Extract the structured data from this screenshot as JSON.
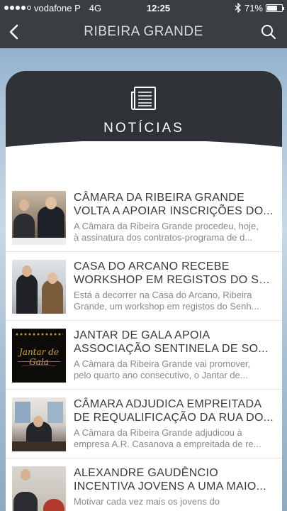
{
  "status_bar": {
    "carrier": "vodafone P",
    "network": "4G",
    "time": "12:25",
    "battery": "71%",
    "battery_level": 0.71,
    "bluetooth_icon": "bluetooth-icon"
  },
  "nav": {
    "title": "RIBEIRA GRANDE",
    "back_icon": "chevron-left-icon",
    "search_icon": "search-icon"
  },
  "header": {
    "icon": "newspaper-icon",
    "title": "NOTÍCIAS"
  },
  "news": [
    {
      "title_line1": "CÂMARA DA RIBEIRA GRANDE",
      "title_line2": "VOLTA A APOIAR INSCRIÇÕES DO...",
      "summary_line1": "A Câmara da Ribeira Grande procedeu, hoje,",
      "summary_line2": "à assinatura dos contratos-programa de d..."
    },
    {
      "title_line1": "CASA DO ARCANO RECEBE",
      "title_line2": "WORKSHOP EM REGISTOS DO SE...",
      "summary_line1": "Está a decorrer na Casa do Arcano, Ribeira",
      "summary_line2": "Grande, um workshop em registos do Senh..."
    },
    {
      "title_line1": "JANTAR DE GALA APOIA",
      "title_line2": "ASSOCIAÇÃO SENTINELA DE SO...",
      "summary_line1": "A Câmara da Ribeira Grande vai promover,",
      "summary_line2": "pelo quarto ano consecutivo, o Jantar de...",
      "thumb_text": "Jantar de Gala"
    },
    {
      "title_line1": "CÂMARA ADJUDICA EMPREITADA",
      "title_line2": "DE REQUALIFICAÇÃO DA RUA DO...",
      "summary_line1": "A Câmara da Ribeira Grande adjudicou à",
      "summary_line2": "empresa A.R. Casanova a empreitada de re..."
    },
    {
      "title_line1": "ALEXANDRE GAUDÊNCIO",
      "title_line2": "INCENTIVA JOVENS A UMA MAIO...",
      "summary_line1": "Motivar cada vez mais os jovens do",
      "summary_line2": ""
    }
  ]
}
